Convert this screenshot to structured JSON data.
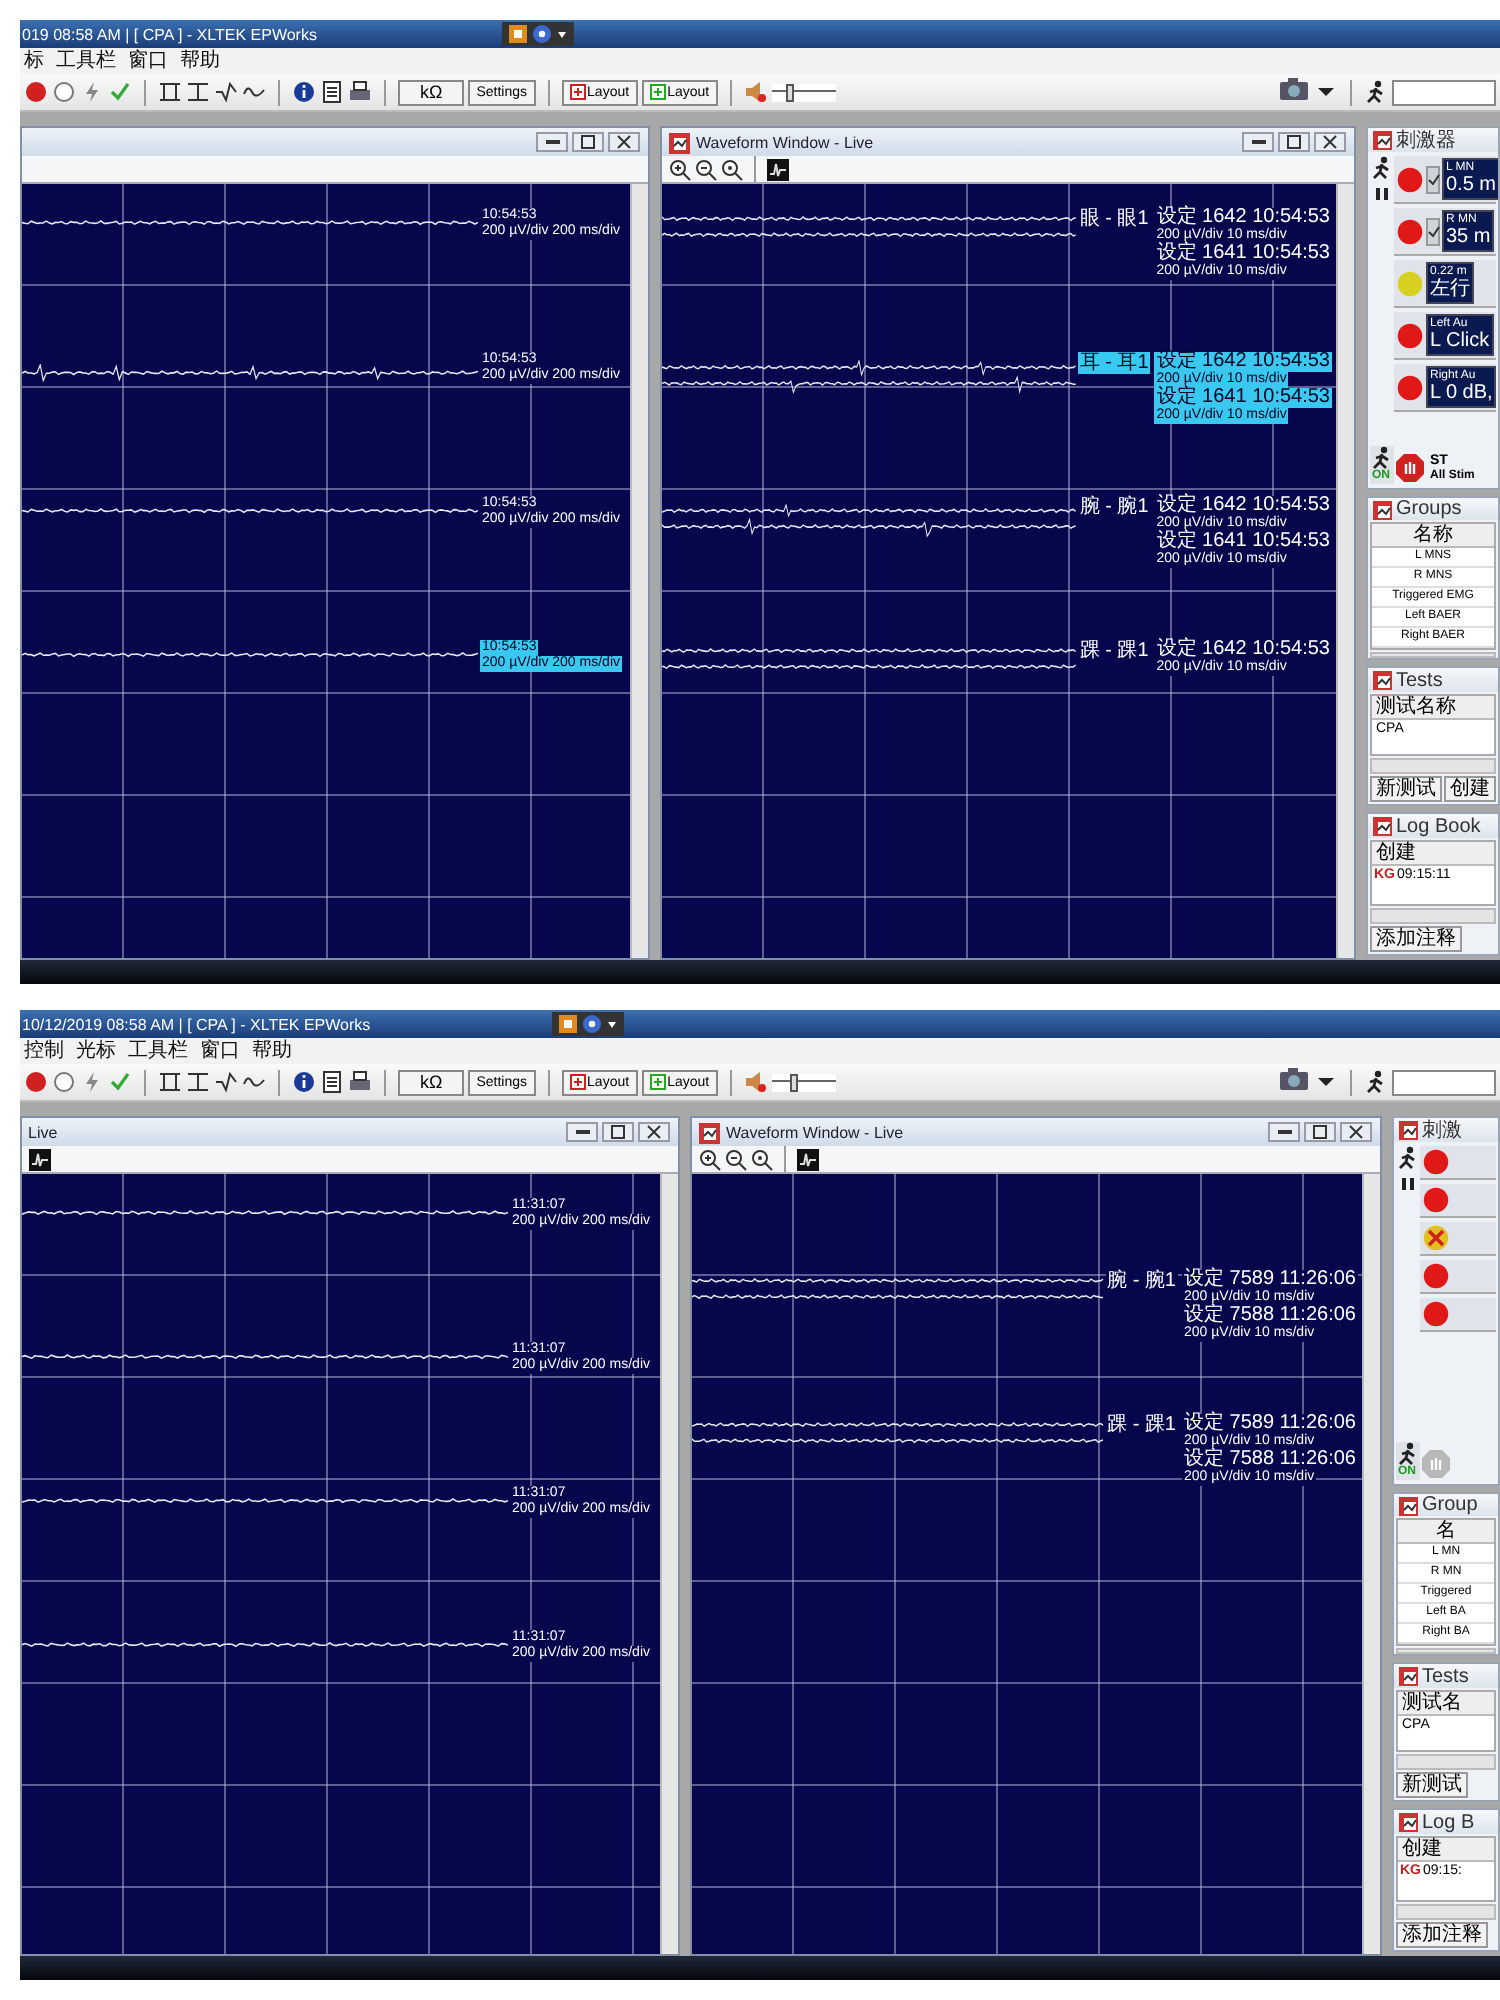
{
  "screens": [
    {
      "title": "019 08:58 AM | [ CPA ] - XLTEK EPWorks",
      "menu": [
        "标",
        "工具栏",
        "窗口",
        "帮助"
      ],
      "toolbar": {
        "text_buttons": [
          "kΩ",
          "Settings",
          "Layout",
          "Layout"
        ],
        "slider": {
          "level": 0.3
        }
      },
      "left_window": {
        "traces": [
          {
            "time": "10:54:53",
            "scale": "200 µV/div 200 ms/div",
            "selected": false
          },
          {
            "time": "10:54:53",
            "scale": "200 µV/div 200 ms/div",
            "selected": false
          },
          {
            "time": "10:54:53",
            "scale": "200 µV/div 200 ms/div",
            "selected": false
          },
          {
            "time": "10:54:53",
            "scale": "200 µV/div 200 ms/div",
            "selected": true
          }
        ]
      },
      "right_window": {
        "title": "Waveform Window - Live",
        "traces": [
          {
            "label": "眼 - 眼1",
            "selected": false,
            "readings": [
              "设定 1642 10:54:53",
              "200 µV/div 10 ms/div",
              "设定 1641 10:54:53",
              "200 µV/div 10 ms/div"
            ]
          },
          {
            "label": "耳 - 耳1",
            "selected": true,
            "readings": [
              "设定 1642 10:54:53",
              "200 µV/div 10 ms/div",
              "设定 1641 10:54:53",
              "200 µV/div 10 ms/div"
            ]
          },
          {
            "label": "腕 - 腕1",
            "selected": false,
            "readings": [
              "设定 1642 10:54:53",
              "200 µV/div 10 ms/div",
              "设定 1641 10:54:53",
              "200 µV/div 10 ms/div"
            ]
          },
          {
            "label": "踝 - 踝1",
            "selected": false,
            "readings": [
              "设定 1642 10:54:53",
              "200 µV/div 10 ms/div"
            ]
          }
        ]
      },
      "side_panel": {
        "stimulator": {
          "title": "刺激器",
          "run_status": "ON",
          "stop_enabled": true,
          "stop_title": "ST",
          "stop_subtitle": "All Stim",
          "items": [
            {
              "kind": "normal",
              "color": "#e01818",
              "checked": true,
              "lines": [
                "L MN",
                "0.5 m"
              ]
            },
            {
              "kind": "normal",
              "color": "#e01818",
              "checked": true,
              "lines": [
                "R MN",
                "35 m"
              ]
            },
            {
              "kind": "normal",
              "color": "#d8d020",
              "checked": false,
              "lines": [
                "0.22 m",
                "左行"
              ]
            },
            {
              "kind": "normal",
              "color": "#e01818",
              "checked": false,
              "lines": [
                "Left Au",
                "L Click"
              ]
            },
            {
              "kind": "normal",
              "color": "#e01818",
              "checked": false,
              "lines": [
                "Right Au",
                "L 0 dB,"
              ]
            }
          ]
        },
        "groups": {
          "title": "Groups",
          "column": "名称",
          "rows": [
            "L MNS",
            "R MNS",
            "Triggered EMG",
            "Left BAER",
            "Right BAER"
          ]
        },
        "tests": {
          "title": "Tests",
          "column": "测试名称",
          "rows": [
            "CPA"
          ],
          "buttons": [
            "新测试",
            "创建"
          ]
        },
        "log_book": {
          "title": "Log Book",
          "column": "创建",
          "rows": [
            {
              "code": "KG",
              "time": "09:15:11"
            }
          ],
          "button": "添加注释"
        }
      }
    },
    {
      "title": "10/12/2019 08:58 AM | [ CPA ] - XLTEK EPWorks",
      "menu": [
        "控制",
        "光标",
        "工具栏",
        "窗口",
        "帮助"
      ],
      "toolbar": {
        "text_buttons": [
          "kΩ",
          "Settings",
          "Layout",
          "Layout"
        ],
        "slider": {
          "level": 0.35
        }
      },
      "left_window": {
        "title": "Live",
        "traces": [
          {
            "time": "11:31:07",
            "scale": "200 µV/div 200 ms/div",
            "selected": false
          },
          {
            "time": "11:31:07",
            "scale": "200 µV/div 200 ms/div",
            "selected": false
          },
          {
            "time": "11:31:07",
            "scale": "200 µV/div 200 ms/div",
            "selected": false
          },
          {
            "time": "11:31:07",
            "scale": "200 µV/div 200 ms/div",
            "selected": false
          }
        ]
      },
      "right_window": {
        "title": "Waveform Window - Live",
        "traces": [
          {
            "label": "腕 - 腕1",
            "selected": false,
            "readings": [
              "设定 7589 11:26:06",
              "200 µV/div 10 ms/div",
              "设定 7588 11:26:06",
              "200 µV/div 10 ms/div"
            ]
          },
          {
            "label": "踝 - 踝1",
            "selected": false,
            "readings": [
              "设定 7589 11:26:06",
              "200 µV/div 10 ms/div",
              "设定 7588 11:26:06",
              "200 µV/div 10 ms/div"
            ]
          }
        ]
      },
      "side_panel": {
        "stimulator": {
          "title": "刺激",
          "run_status": "ON",
          "stop_enabled": false,
          "items": [
            {
              "kind": "normal",
              "color": "#e01818",
              "checked": false
            },
            {
              "kind": "normal",
              "color": "#e01818",
              "checked": false
            },
            {
              "kind": "fault",
              "color": "#e0c020",
              "checked": false
            },
            {
              "kind": "normal",
              "color": "#e01818",
              "checked": false
            },
            {
              "kind": "normal",
              "color": "#e01818",
              "checked": false
            }
          ]
        },
        "groups": {
          "title": "Group",
          "column": "名",
          "rows": [
            "L MN",
            "R MN",
            "Triggered",
            "Left BA",
            "Right BA"
          ]
        },
        "tests": {
          "title": "Tests",
          "column": "测试名",
          "rows": [
            "CPA"
          ],
          "buttons": [
            "新测试"
          ]
        },
        "log_book": {
          "title": "Log B",
          "column": "创建",
          "rows": [
            {
              "code": "KG",
              "time": "09:15:"
            }
          ],
          "button": "添加注释"
        }
      }
    }
  ]
}
